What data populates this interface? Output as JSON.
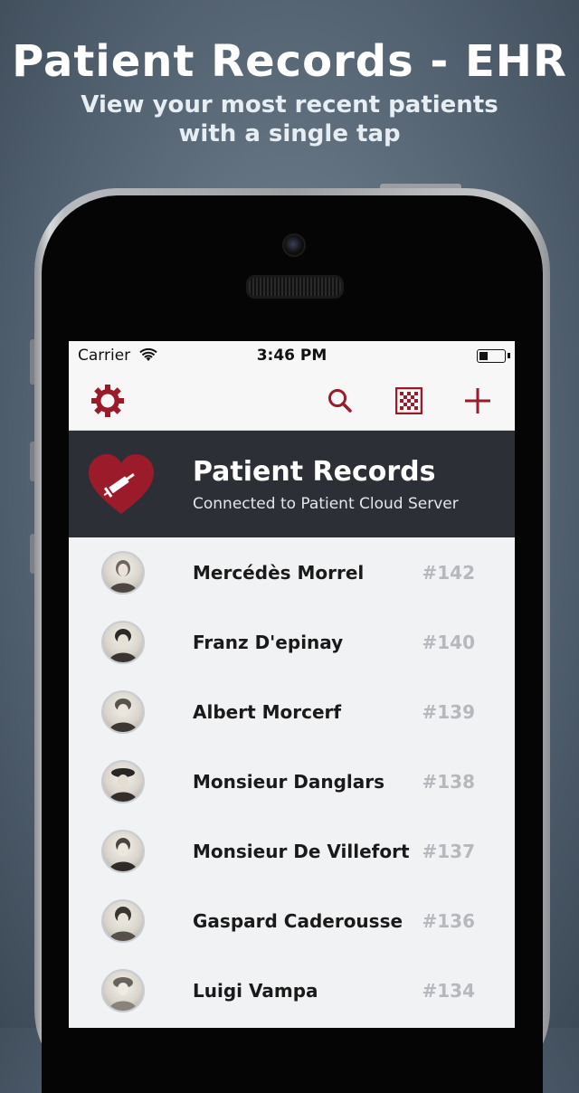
{
  "promo": {
    "title": "Patient Records - EHR",
    "subtitle": "View your most recent patients with a single tap"
  },
  "status_bar": {
    "carrier": "Carrier",
    "time": "3:46 PM",
    "battery_level": 0.3
  },
  "toolbar": {
    "icons": [
      "gear-icon",
      "search-icon",
      "qr-code-icon",
      "plus-icon"
    ],
    "accent_color": "#9b1b2a"
  },
  "banner": {
    "title": "Patient Records",
    "subtitle": "Connected to Patient Cloud Server",
    "logo": "heart-syringe-icon",
    "background_color": "#2d2f36"
  },
  "patients": [
    {
      "name": "Mercédès Morrel",
      "number": "#142"
    },
    {
      "name": "Franz D'epinay",
      "number": "#140"
    },
    {
      "name": "Albert Morcerf",
      "number": "#139"
    },
    {
      "name": "Monsieur Danglars",
      "number": "#138"
    },
    {
      "name": "Monsieur De Villefort",
      "number": "#137"
    },
    {
      "name": "Gaspard Caderousse",
      "number": "#136"
    },
    {
      "name": "Luigi Vampa",
      "number": "#134"
    }
  ]
}
